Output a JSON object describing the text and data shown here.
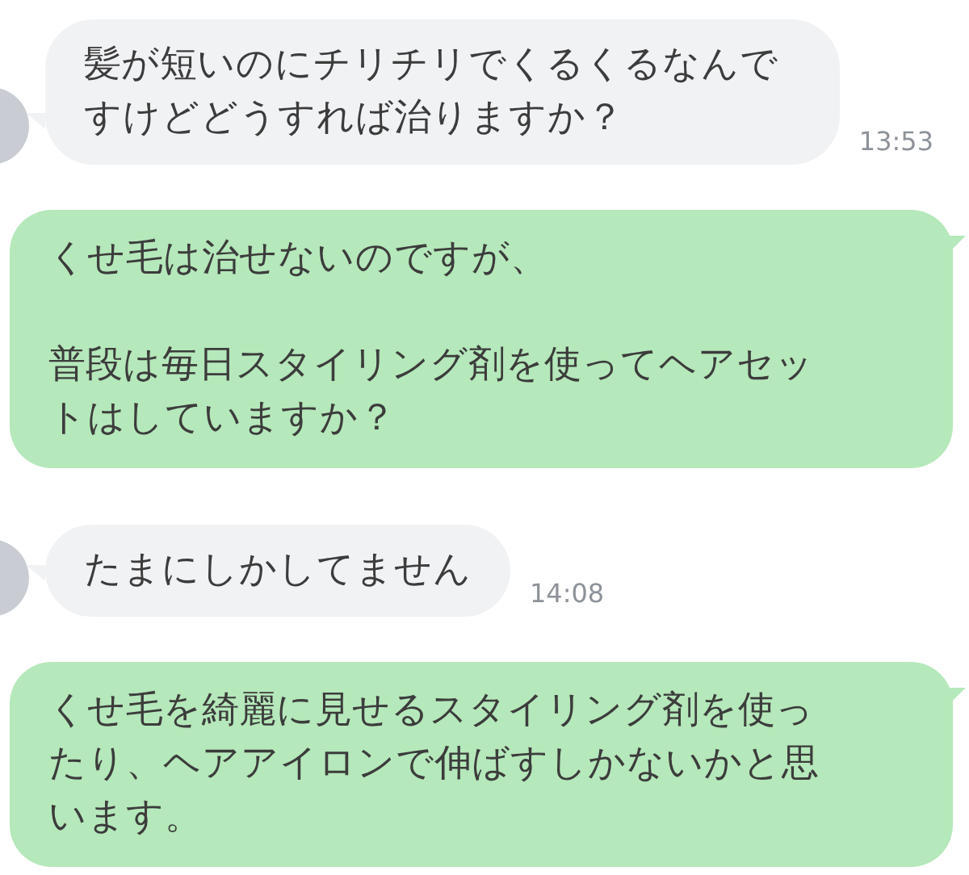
{
  "messages": [
    {
      "kind": "received",
      "paragraphs": [
        "髪が短いのにチリチリでくるくるなんですけどどうすれば治りますか？"
      ],
      "time": "13:53"
    },
    {
      "kind": "sent",
      "paragraphs": [
        "くせ毛は治せないのですが、",
        "普段は毎日スタイリング剤を使ってヘアセットはしていますか？"
      ]
    },
    {
      "kind": "received",
      "paragraphs": [
        "たまにしかしてません"
      ],
      "time": "14:08"
    },
    {
      "kind": "sent",
      "paragraphs": [
        "くせ毛を綺麗に見せるスタイリング剤を使ったり、ヘアアイロンで伸ばすしかないかと思います。"
      ]
    }
  ]
}
